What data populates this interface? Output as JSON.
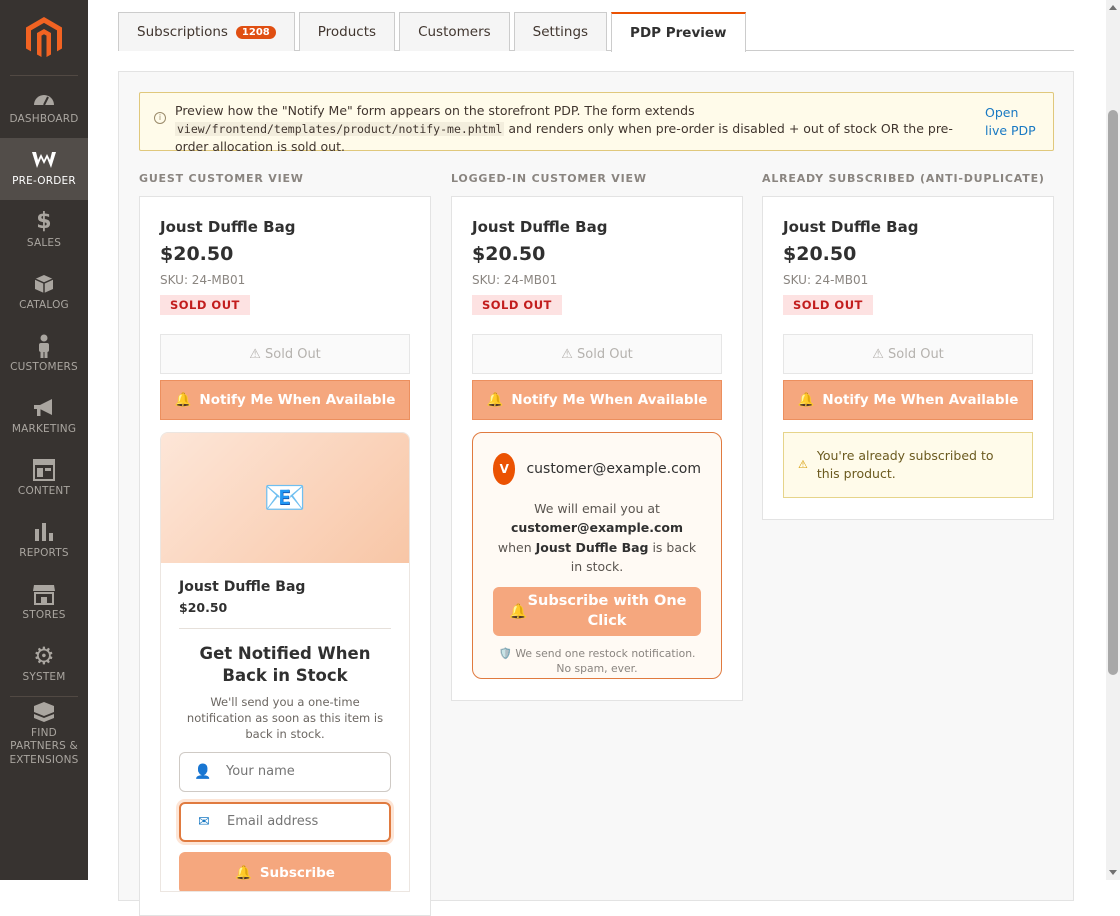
{
  "sidebar": {
    "items": [
      {
        "label": "DASHBOARD"
      },
      {
        "label": "PRE-ORDER"
      },
      {
        "label": "SALES"
      },
      {
        "label": "CATALOG"
      },
      {
        "label": "CUSTOMERS"
      },
      {
        "label": "MARKETING"
      },
      {
        "label": "CONTENT"
      },
      {
        "label": "REPORTS"
      },
      {
        "label": "STORES"
      },
      {
        "label": "SYSTEM"
      },
      {
        "label": "FIND PARTNERS & EXTENSIONS"
      }
    ]
  },
  "tabs": [
    {
      "label": "Subscriptions",
      "badge": "1208"
    },
    {
      "label": "Products"
    },
    {
      "label": "Customers"
    },
    {
      "label": "Settings"
    },
    {
      "label": "PDP Preview"
    }
  ],
  "info": {
    "text_1": "Preview how the \"Notify Me\" form appears on the storefront PDP. The form extends ",
    "code": "view/frontend/templates/product/notify-me.phtml",
    "text_2": " and renders only when pre-order is disabled + out of stock OR the pre-order allocation is sold out.",
    "link": "Open live PDP"
  },
  "columns": {
    "guest": {
      "label": "GUEST CUSTOMER VIEW"
    },
    "logged": {
      "label": "LOGGED-IN CUSTOMER VIEW"
    },
    "already": {
      "label": "ALREADY SUBSCRIBED (ANTI-DUPLICATE)"
    }
  },
  "product": {
    "name": "Joust Duffle Bag",
    "price": "$20.50",
    "sku": "SKU: 24-MB01",
    "badge": "SOLD OUT",
    "soldout_button": "⚠ Sold Out",
    "notify_button": "Notify Me When Available"
  },
  "guest_form": {
    "product_name": "Joust Duffle Bag",
    "price": "$20.50",
    "heading": "Get Notified When Back in Stock",
    "description": "We'll send you a one-time notification as soon as this item is back in stock.",
    "name_placeholder": "Your name",
    "email_placeholder": "Email address",
    "submit": "Subscribe"
  },
  "logged_in": {
    "avatar": "V",
    "email": "customer@example.com",
    "msg_1": "We will email you at ",
    "msg_email": "customer@example.com",
    "msg_2": " when ",
    "msg_product": "Joust Duffle Bag",
    "msg_3": " is back in stock.",
    "button": "Subscribe with One Click",
    "note": "We send one restock notification. No spam, ever."
  },
  "already": {
    "message": "You're already subscribed to this product."
  },
  "colors": {
    "accent": "#eb5202",
    "sidebar": "#373330",
    "notify": "#f5a77e"
  }
}
